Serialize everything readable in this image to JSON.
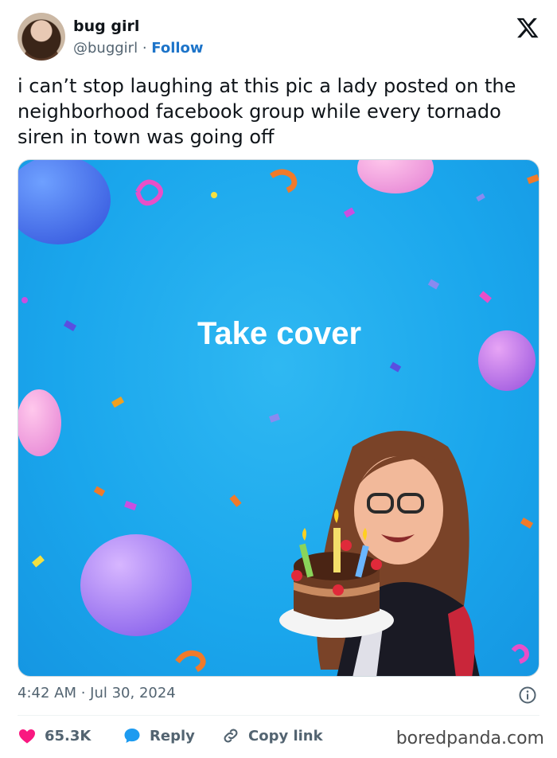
{
  "tweet": {
    "author_name": "bug girl",
    "handle": "@buggirl",
    "separator": " · ",
    "follow_label": "Follow",
    "text": "i can’t stop laughing at this pic a lady posted on the neighborhood facebook group while every tornado siren in town was going off",
    "timestamp": "4:42 AM · Jul 30, 2024"
  },
  "media": {
    "overlay_text": "Take cover",
    "background_color": "#1aa6ec"
  },
  "actions": {
    "likes": "65.3K",
    "reply_label": "Reply",
    "copy_label": "Copy link"
  },
  "colors": {
    "like_heart": "#f91880",
    "reply_bubble": "#1d9bf0",
    "follow_link": "#1d74c9"
  },
  "icons": {
    "brand": "x-logo-icon",
    "like": "heart-icon",
    "reply": "speech-bubble-icon",
    "copy": "link-icon",
    "info": "info-icon"
  },
  "watermark": "boredpanda.com"
}
